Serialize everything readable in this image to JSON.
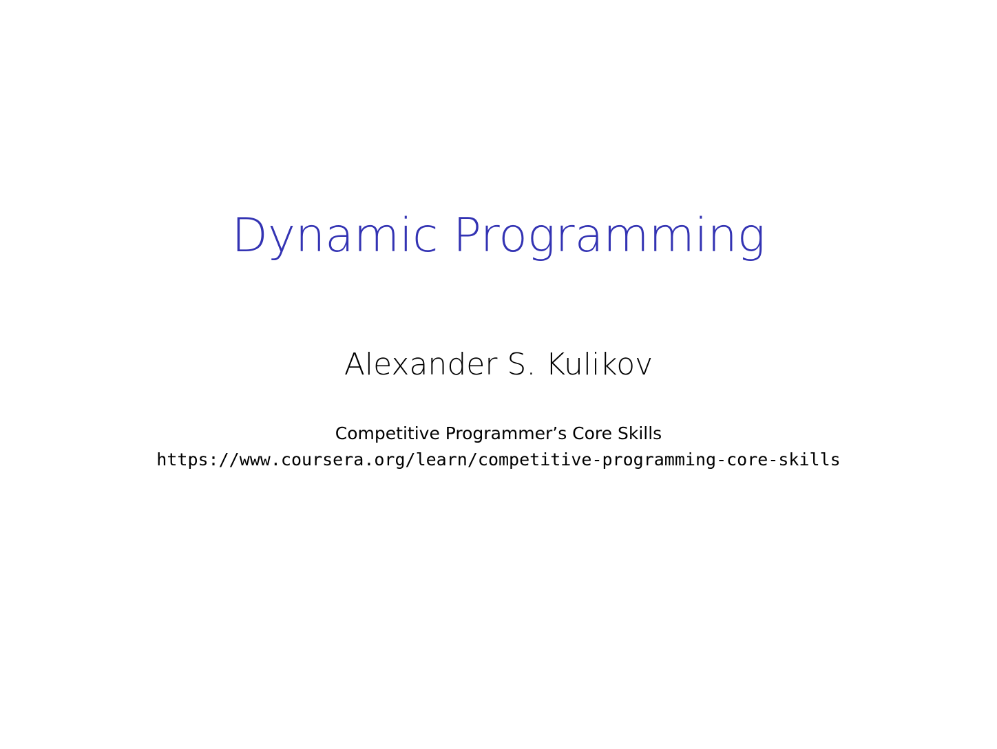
{
  "slide": {
    "title": "Dynamic Programming",
    "author": "Alexander S. Kulikov",
    "course": "Competitive Programmer’s Core Skills",
    "url": "https://www.coursera.org/learn/competitive-programming-core-skills"
  },
  "colors": {
    "title": "#3333b3",
    "text": "#000000",
    "background": "#ffffff"
  }
}
